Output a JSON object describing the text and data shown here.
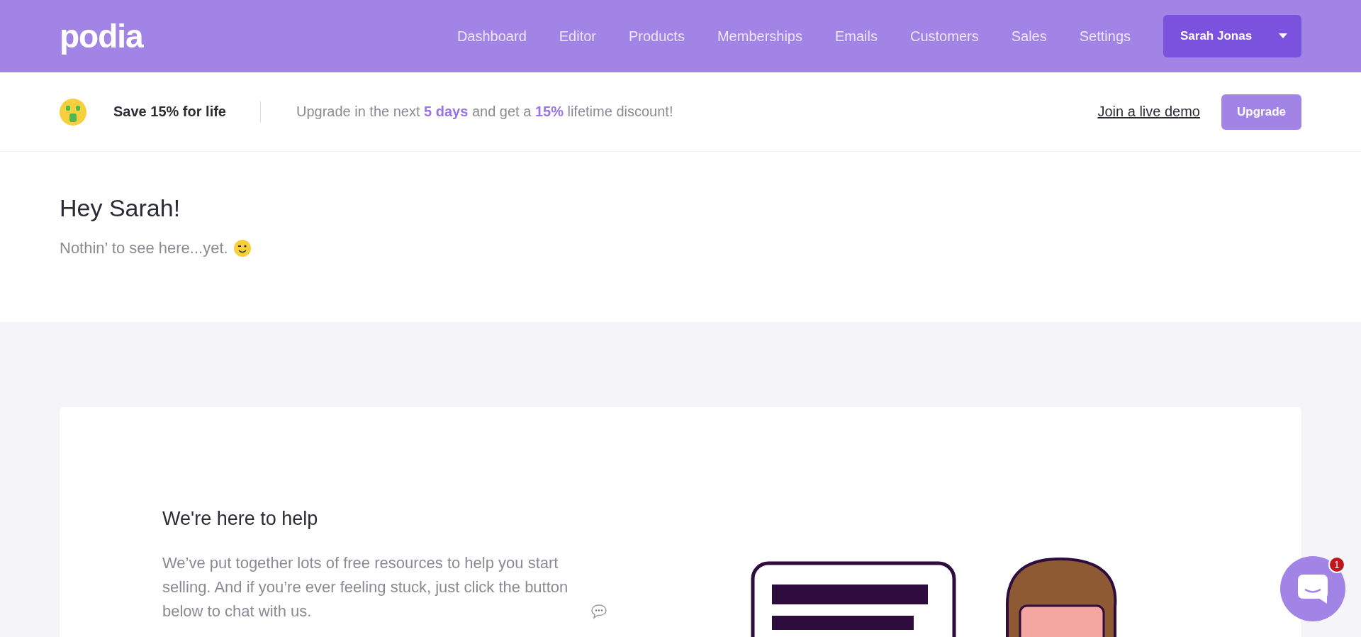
{
  "header": {
    "logo": "podia",
    "nav": [
      "Dashboard",
      "Editor",
      "Products",
      "Memberships",
      "Emails",
      "Customers",
      "Sales",
      "Settings"
    ],
    "account": "Sarah Jonas"
  },
  "promo": {
    "title": "Save 15% for life",
    "message": "Upgrade in the next **5 days** and get a **15%** lifetime discount!",
    "demo_link": "Join a live demo",
    "upgrade_button": "Upgrade"
  },
  "greeting": {
    "title": "Hey Sarah!",
    "subtitle": "Nothin’ to see here...yet."
  },
  "help_card": {
    "title": "We're here to help",
    "text": "We’ve put together lots of free resources to help you start selling. And if you’re ever feeling stuck, just click the button below to chat with us."
  },
  "chat": {
    "badge": "1"
  }
}
